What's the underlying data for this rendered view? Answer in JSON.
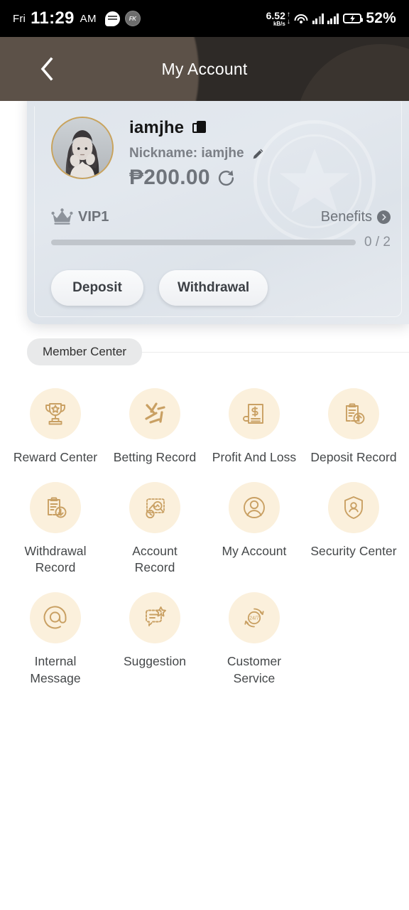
{
  "status_bar": {
    "day": "Fri",
    "time": "11:29",
    "ampm": "AM",
    "net_speed": "6.52",
    "net_unit": "kB/s",
    "up_arrow": "↑",
    "down_arrow": "↓",
    "battery_percent": "52%",
    "icons": [
      "chat-bubble-icon",
      "fk-badge-icon",
      "wifi-icon",
      "signal-bars-icon",
      "battery-charging-icon"
    ],
    "fk_badge": "FK"
  },
  "header": {
    "title": "My Account",
    "back_icon": "chevron-left-icon"
  },
  "profile": {
    "username": "iamjhe",
    "copy_icon": "copy-icon",
    "nickname_label": "Nickname: iamjhe",
    "edit_icon": "pencil-icon",
    "balance": "₱200.00",
    "refresh_icon": "refresh-icon",
    "vip_level": "VIP1",
    "crown_icon": "crown-icon",
    "benefits_label": "Benefits",
    "benefits_icon": "chevron-right-circle-icon",
    "progress_text": "0 / 2",
    "progress_current": 0,
    "progress_max": 2,
    "deposit_label": "Deposit",
    "withdrawal_label": "Withdrawal"
  },
  "member_center": {
    "section_label": "Member Center",
    "tiles": [
      {
        "label": "Reward Center",
        "icon": "trophy-icon"
      },
      {
        "label": "Betting Record",
        "icon": "betting-sticks-icon"
      },
      {
        "label": "Profit And Loss",
        "icon": "document-dollar-icon"
      },
      {
        "label": "Deposit Record",
        "icon": "clipboard-up-arrow-icon"
      },
      {
        "label": "Withdrawal Record",
        "icon": "clipboard-down-arrow-icon"
      },
      {
        "label": "Account Record",
        "icon": "chart-magnifier-clock-icon"
      },
      {
        "label": "My Account",
        "icon": "person-circle-icon"
      },
      {
        "label": "Security Center",
        "icon": "shield-person-icon"
      },
      {
        "label": "Internal Message",
        "icon": "at-sign-icon"
      },
      {
        "label": "Suggestion",
        "icon": "chat-star-icon"
      },
      {
        "label": "Customer Service",
        "icon": "support-247-icon"
      }
    ]
  },
  "colors": {
    "header_bg": "#2e2a27",
    "card_bg": "#e1e7ed",
    "icon_circle": "#fbf0dc",
    "icon_stroke": "#c9a063",
    "avatar_ring": "#c9a35c",
    "label_text": "#444749"
  }
}
